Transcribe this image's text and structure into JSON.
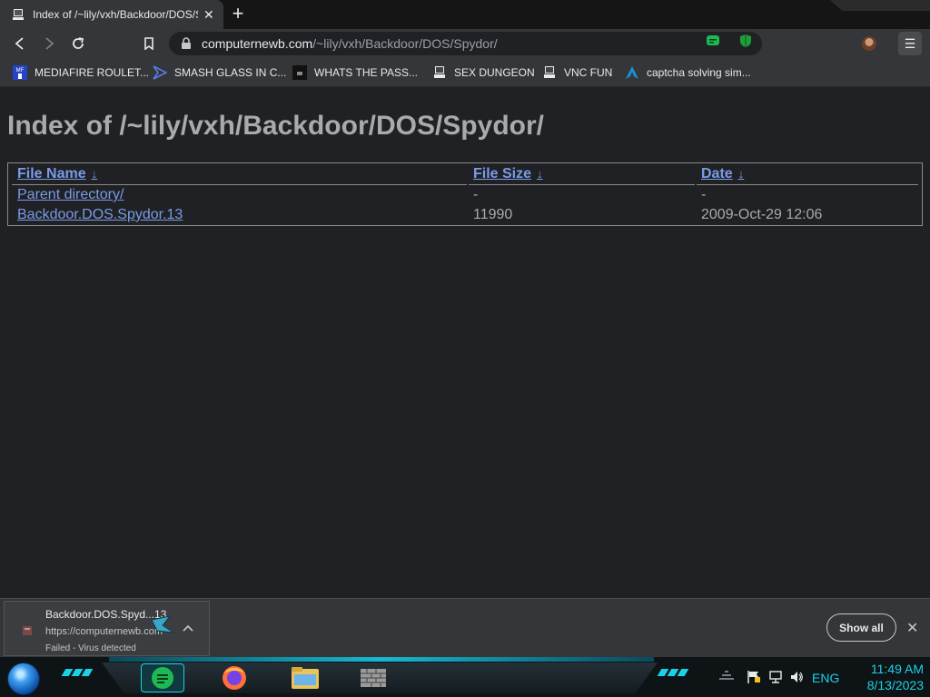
{
  "browser": {
    "tab": {
      "title": "Index of /~lily/vxh/Backdoor/DOS/Spydor/",
      "close": "✕"
    },
    "new_tab": "+",
    "url_domain": "computernewb.com",
    "url_path": "/~lily/vxh/Backdoor/DOS/Spydor/",
    "menu": "☰",
    "bookmarks": [
      {
        "label": "MEDIAFIRE ROULET...",
        "icon": "mediafire-icon"
      },
      {
        "label": "SMASH GLASS IN C...",
        "icon": "vs-icon"
      },
      {
        "label": "WHATS THE PASS...",
        "icon": "dark-icon"
      },
      {
        "label": "SEX DUNGEON",
        "icon": "computer-icon"
      },
      {
        "label": "VNC FUN",
        "icon": "computer-icon"
      },
      {
        "label": "captcha solving sim...",
        "icon": "arch-icon"
      }
    ]
  },
  "page": {
    "title": "Index of /~lily/vxh/Backdoor/DOS/Spydor/",
    "headers": {
      "name": "File Name",
      "size": "File Size",
      "date": "Date",
      "sort_arrow": "↓"
    },
    "rows": [
      {
        "name": "Parent directory/",
        "size": "-",
        "date": "-"
      },
      {
        "name": "Backdoor.DOS.Spydor.13",
        "size": "11990",
        "date": "2009-Oct-29 12:06"
      }
    ]
  },
  "download": {
    "name": "Backdoor.DOS.Spyd...13",
    "url": "https://computernewb.com",
    "status": "Failed - Virus detected",
    "show_all": "Show all",
    "close": "✕"
  },
  "taskbar": {
    "language": "ENG",
    "time": "11:49 AM",
    "date": "8/13/2023"
  },
  "colors": {
    "link": "#7a9be8",
    "accent": "#1ad2e8",
    "page_bg": "#202124"
  }
}
